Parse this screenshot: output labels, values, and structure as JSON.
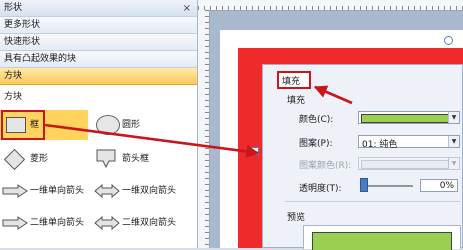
{
  "left_panel": {
    "title": "形状",
    "close_glyph": "×",
    "sections": [
      "更多形状",
      "快速形状",
      "具有凸起效果的块",
      "方块"
    ],
    "sub_header": "方块",
    "shapes": [
      {
        "label": "框"
      },
      {
        "label": "圆形"
      },
      {
        "label": "菱形"
      },
      {
        "label": "箭头框"
      },
      {
        "label": "一维单向箭头"
      },
      {
        "label": "一维双向箭头"
      },
      {
        "label": "二维单向箭头"
      },
      {
        "label": "二维双向箭头"
      }
    ]
  },
  "dialog": {
    "callout": "填充",
    "section_title": "填充",
    "rows": [
      {
        "label": "颜色(C):",
        "value": ""
      },
      {
        "label": "图案(P):",
        "value": "01: 纯色"
      },
      {
        "label": "图案颜色(R):",
        "value": ""
      },
      {
        "label": "透明度(T):",
        "value": "0%"
      }
    ],
    "preview_title": "预览"
  },
  "colors": {
    "highlight_red": "#c8161d",
    "fill_green": "#9ad051",
    "frame_red": "#ee2a2a",
    "selected_section": "#fbc95b"
  }
}
